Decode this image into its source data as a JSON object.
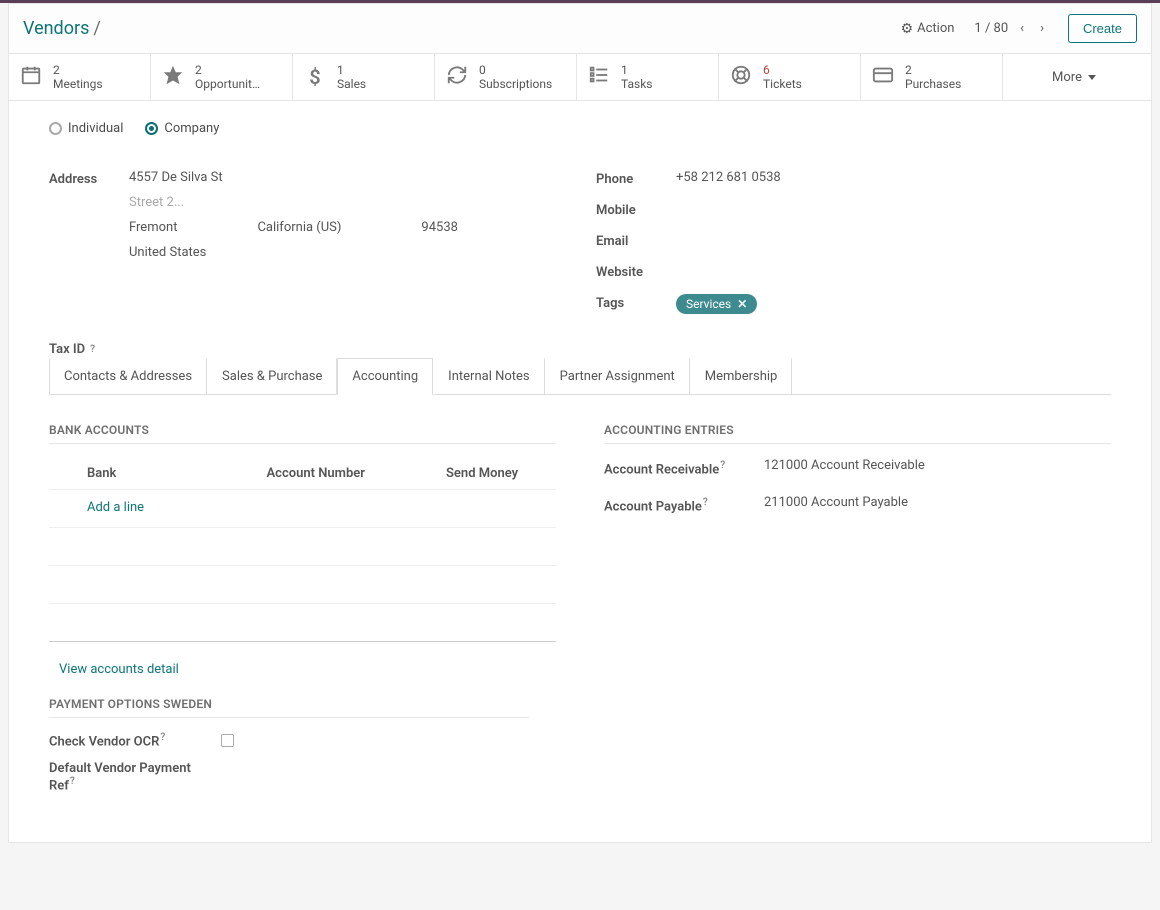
{
  "breadcrumb": {
    "root": "Vendors",
    "slash": "/"
  },
  "header": {
    "action_label": "Action",
    "pager": "1 / 80",
    "create_label": "Create"
  },
  "stats": {
    "meetings": {
      "count": "2",
      "label": "Meetings"
    },
    "opportunities": {
      "count": "2",
      "label": "Opportunit…"
    },
    "sales": {
      "count": "1",
      "label": "Sales"
    },
    "subscriptions": {
      "count": "0",
      "label": "Subscriptions"
    },
    "tasks": {
      "count": "1",
      "label": "Tasks"
    },
    "tickets": {
      "count": "6",
      "label": "Tickets"
    },
    "purchases": {
      "count": "2",
      "label": "Purchases"
    },
    "more": {
      "label": "More"
    }
  },
  "type_radio": {
    "individual": "Individual",
    "company": "Company"
  },
  "left": {
    "address_label": "Address",
    "street1": "4557 De Silva St",
    "street2_placeholder": "Street 2...",
    "city": "Fremont",
    "state": "California (US)",
    "zip": "94538",
    "country": "United States",
    "taxid_label": "Tax ID"
  },
  "right": {
    "phone_label": "Phone",
    "phone_value": "+58 212 681 0538",
    "mobile_label": "Mobile",
    "email_label": "Email",
    "website_label": "Website",
    "tags_label": "Tags",
    "tag1": "Services"
  },
  "tabs": {
    "contacts": "Contacts & Addresses",
    "salespurchase": "Sales & Purchase",
    "accounting": "Accounting",
    "internal": "Internal Notes",
    "partner": "Partner Assignment",
    "membership": "Membership"
  },
  "bank": {
    "section_title": "BANK ACCOUNTS",
    "col_bank": "Bank",
    "col_acc": "Account Number",
    "col_send": "Send Money",
    "add_a_line": "Add a line",
    "view_detail": "View accounts detail"
  },
  "entries": {
    "section_title": "ACCOUNTING ENTRIES",
    "receivable_label": "Account Receivable",
    "receivable_value": "121000 Account Receivable",
    "payable_label": "Account Payable",
    "payable_value": "211000 Account Payable"
  },
  "po": {
    "section_title": "PAYMENT OPTIONS SWEDEN",
    "check_vendor_ocr": "Check Vendor OCR",
    "default_ref": "Default Vendor Payment Ref"
  },
  "help": "?"
}
